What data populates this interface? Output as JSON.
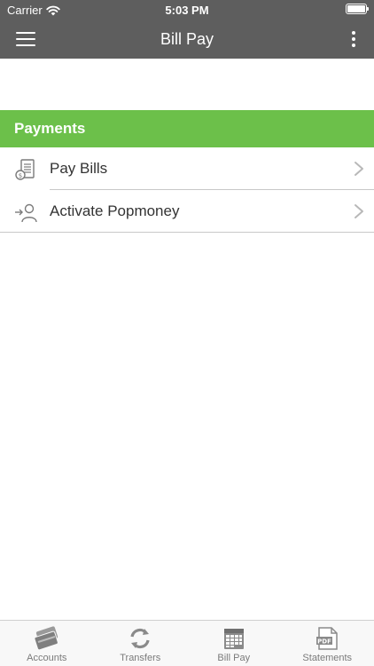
{
  "status_bar": {
    "carrier": "Carrier",
    "time": "5:03 PM"
  },
  "nav": {
    "title": "Bill Pay"
  },
  "section": {
    "title": "Payments"
  },
  "items": [
    {
      "label": "Pay Bills",
      "icon": "bill-icon"
    },
    {
      "label": "Activate Popmoney",
      "icon": "person-transfer-icon"
    }
  ],
  "tabs": [
    {
      "label": "Accounts",
      "icon": "cards-icon"
    },
    {
      "label": "Transfers",
      "icon": "refresh-arrows-icon"
    },
    {
      "label": "Bill Pay",
      "icon": "calendar-icon"
    },
    {
      "label": "Statements",
      "icon": "pdf-document-icon"
    }
  ],
  "colors": {
    "header_bg": "#5e5e5e",
    "accent_green": "#6cc04a",
    "icon_gray": "#8a8a8a"
  }
}
